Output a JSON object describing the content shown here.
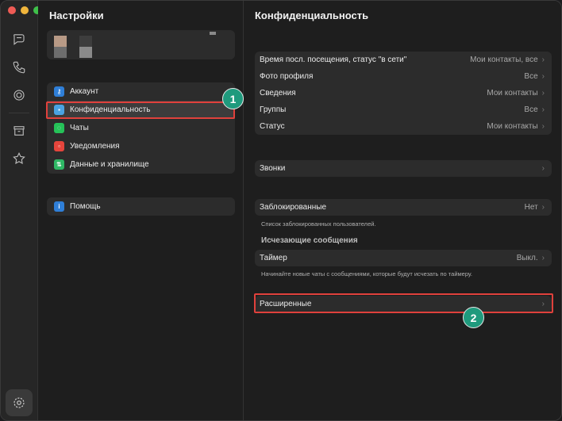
{
  "sidebar_title": "Настройки",
  "menu_group1": [
    {
      "label": "Аккаунт",
      "icon": "key-icon",
      "color": "#2f7fd8"
    },
    {
      "label": "Конфиденциальность",
      "icon": "lock-icon",
      "color": "#4aa3e3"
    },
    {
      "label": "Чаты",
      "icon": "whatsapp-icon",
      "color": "#25c258"
    },
    {
      "label": "Уведомления",
      "icon": "bell-icon",
      "color": "#e5453c"
    },
    {
      "label": "Данные и хранилище",
      "icon": "arrows-icon",
      "color": "#2fb865"
    }
  ],
  "menu_group2": [
    {
      "label": "Помощь",
      "icon": "info-icon",
      "color": "#2f7fd8"
    }
  ],
  "panel_title": "Конфиденциальность",
  "privacy_rows": [
    {
      "label": "Время посл. посещения, статус \"в сети\"",
      "value": "Мои контакты, все"
    },
    {
      "label": "Фото профиля",
      "value": "Все"
    },
    {
      "label": "Сведения",
      "value": "Мои контакты"
    },
    {
      "label": "Группы",
      "value": "Все"
    },
    {
      "label": "Статус",
      "value": "Мои контакты"
    }
  ],
  "calls_row": {
    "label": "Звонки"
  },
  "blocked_row": {
    "label": "Заблокированные",
    "value": "Нет"
  },
  "blocked_note": "Список заблокированных пользователей.",
  "disappearing_title": "Исчезающие сообщения",
  "timer_row": {
    "label": "Таймер",
    "value": "Выкл."
  },
  "timer_note": "Начинайте новые чаты с сообщениями, которые будут исчезать по таймеру.",
  "advanced_row": {
    "label": "Расширенные"
  },
  "chevron": "›",
  "badges": [
    "1",
    "2"
  ],
  "colors": {
    "highlight": "#e0413c",
    "badge": "#1f9a7d"
  }
}
